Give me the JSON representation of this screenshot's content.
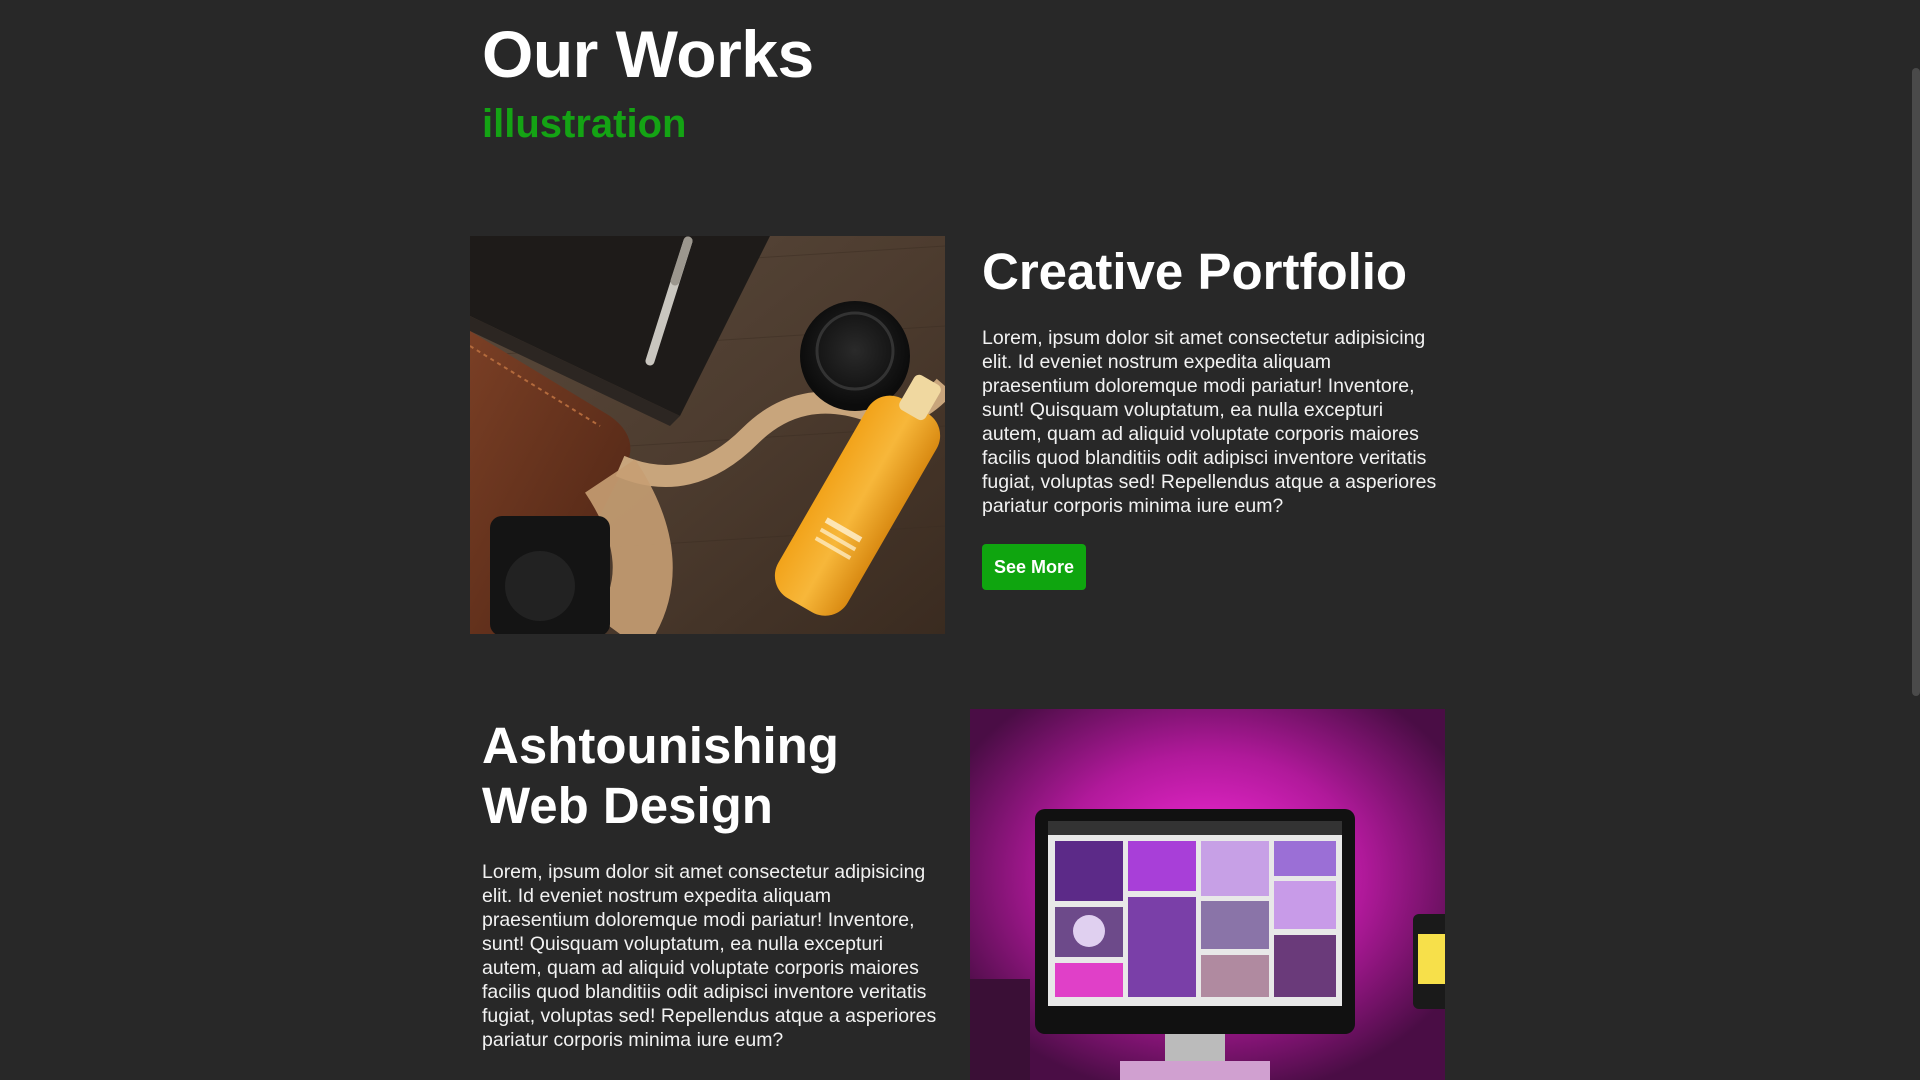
{
  "header": {
    "title": "Our Works",
    "subtitle": "illustration"
  },
  "works": [
    {
      "title": "Creative Portfolio",
      "description": "Lorem, ipsum dolor sit amet consectetur adipisicing elit. Id eveniet nostrum expedita aliquam praesentium doloremque modi pariatur! Inventore, sunt! Quisquam voluptatum, ea nulla excepturi autem, quam ad aliquid voluptate corporis maiores facilis quod blanditiis odit adipisci inventore veritatis fugiat, voluptas sed! Repellendus atque a asperiores pariatur corporis minima iure eum?",
      "button_label": "See More",
      "image_alt": "camera bag, lens cap, pen and juice bottle flat lay"
    },
    {
      "title": "Ashtounishing Web Design",
      "description": "Lorem, ipsum dolor sit amet consectetur adipisicing elit. Id eveniet nostrum expedita aliquam praesentium doloremque modi pariatur! Inventore, sunt! Quisquam voluptatum, ea nulla excepturi autem, quam ad aliquid voluptate corporis maiores facilis quod blanditiis odit adipisci inventore veritatis fugiat, voluptas sed! Repellendus atque a asperiores pariatur corporis minima iure eum?",
      "image_alt": "desktop computer with purple neon lighting"
    }
  ],
  "colors": {
    "background": "#282828",
    "accent": "#14a314",
    "button": "#0fa50f",
    "text": "#ffffff"
  }
}
